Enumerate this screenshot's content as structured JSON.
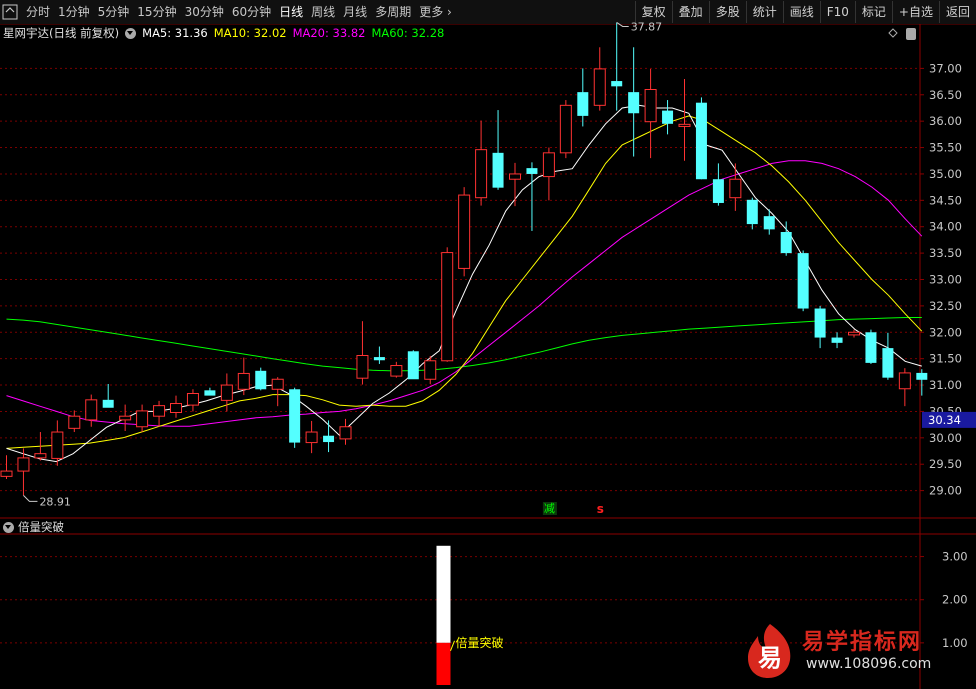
{
  "toolbar": {
    "left_items": [
      "分时",
      "1分钟",
      "5分钟",
      "15分钟",
      "30分钟",
      "60分钟",
      "日线",
      "周线",
      "月线",
      "多周期",
      "更多"
    ],
    "active": "日线",
    "right_items": [
      "复权",
      "叠加",
      "多股",
      "统计",
      "画线",
      "F10",
      "标记",
      "+自选",
      "返回"
    ]
  },
  "header": {
    "stock": "星网宇达(日线 前复权)",
    "ma5": "MA5: 31.36",
    "ma10": "MA10: 32.02",
    "ma20": "MA20: 33.82",
    "ma60": "MA60: 32.28",
    "colors": {
      "ma5": "#ffffff",
      "ma10": "#ffff00",
      "ma20": "#ff00ff",
      "ma60": "#00ff00"
    }
  },
  "sub_header": {
    "title": "倍量突破"
  },
  "annotations": {
    "high_label": "37.87",
    "low_label": "28.91",
    "current_price": "30.34",
    "minus_marker": "减",
    "s_marker": "s",
    "signal_label": "倍量突破"
  },
  "watermark": {
    "title": "易学指标网",
    "url": "www.108096.com",
    "logo_char": "易"
  },
  "chart_data": [
    {
      "type": "candlestick",
      "title": "星网宇达(日线 前复权)",
      "ylim": [
        28.5,
        37.5
      ],
      "y_ticks": [
        "37.00",
        "36.50",
        "36.00",
        "35.50",
        "35.00",
        "34.50",
        "34.00",
        "33.50",
        "33.00",
        "32.50",
        "32.00",
        "31.50",
        "31.00",
        "30.50",
        "30.00",
        "29.50",
        "29.00"
      ],
      "candles": [
        {
          "o": 29.27,
          "h": 29.67,
          "l": 29.22,
          "c": 29.37
        },
        {
          "o": 29.37,
          "h": 29.8,
          "l": 28.91,
          "c": 29.62
        },
        {
          "o": 29.62,
          "h": 30.11,
          "l": 29.57,
          "c": 29.7
        },
        {
          "o": 29.61,
          "h": 30.33,
          "l": 29.47,
          "c": 30.11
        },
        {
          "o": 30.18,
          "h": 30.52,
          "l": 30.11,
          "c": 30.41
        },
        {
          "o": 30.34,
          "h": 30.82,
          "l": 30.21,
          "c": 30.72
        },
        {
          "o": 30.72,
          "h": 31.02,
          "l": 30.58,
          "c": 30.57
        },
        {
          "o": 30.34,
          "h": 30.63,
          "l": 30.13,
          "c": 30.41
        },
        {
          "o": 30.21,
          "h": 30.63,
          "l": 30.11,
          "c": 30.51
        },
        {
          "o": 30.41,
          "h": 30.7,
          "l": 30.21,
          "c": 30.61
        },
        {
          "o": 30.48,
          "h": 30.8,
          "l": 30.38,
          "c": 30.65
        },
        {
          "o": 30.62,
          "h": 30.92,
          "l": 30.5,
          "c": 30.84
        },
        {
          "o": 30.9,
          "h": 30.95,
          "l": 30.85,
          "c": 30.8
        },
        {
          "o": 30.71,
          "h": 31.22,
          "l": 30.5,
          "c": 31.0
        },
        {
          "o": 30.92,
          "h": 31.52,
          "l": 30.81,
          "c": 31.22
        },
        {
          "o": 31.27,
          "h": 31.33,
          "l": 30.9,
          "c": 30.92
        },
        {
          "o": 30.92,
          "h": 31.15,
          "l": 30.6,
          "c": 31.11
        },
        {
          "o": 30.92,
          "h": 30.95,
          "l": 29.81,
          "c": 29.91
        },
        {
          "o": 29.91,
          "h": 30.32,
          "l": 29.71,
          "c": 30.11
        },
        {
          "o": 30.04,
          "h": 30.33,
          "l": 29.73,
          "c": 29.92
        },
        {
          "o": 29.98,
          "h": 30.36,
          "l": 29.87,
          "c": 30.21
        },
        {
          "o": 31.13,
          "h": 32.21,
          "l": 31.01,
          "c": 31.56
        },
        {
          "o": 31.53,
          "h": 31.73,
          "l": 31.4,
          "c": 31.47
        },
        {
          "o": 31.17,
          "h": 31.44,
          "l": 31.14,
          "c": 31.37
        },
        {
          "o": 31.64,
          "h": 31.66,
          "l": 31.17,
          "c": 31.11
        },
        {
          "o": 31.11,
          "h": 31.55,
          "l": 31.02,
          "c": 31.46
        },
        {
          "o": 31.46,
          "h": 33.61,
          "l": 31.44,
          "c": 33.51
        },
        {
          "o": 33.21,
          "h": 34.75,
          "l": 33.06,
          "c": 34.6
        },
        {
          "o": 34.55,
          "h": 36.01,
          "l": 34.4,
          "c": 35.46
        },
        {
          "o": 35.4,
          "h": 36.21,
          "l": 34.7,
          "c": 34.74
        },
        {
          "o": 34.9,
          "h": 35.21,
          "l": 34.39,
          "c": 35.0
        },
        {
          "o": 35.11,
          "h": 35.22,
          "l": 33.92,
          "c": 35.0
        },
        {
          "o": 34.95,
          "h": 35.5,
          "l": 34.5,
          "c": 35.4
        },
        {
          "o": 35.4,
          "h": 36.4,
          "l": 35.3,
          "c": 36.3
        },
        {
          "o": 36.55,
          "h": 37.0,
          "l": 35.9,
          "c": 36.1
        },
        {
          "o": 36.3,
          "h": 37.4,
          "l": 36.2,
          "c": 36.99
        },
        {
          "o": 36.76,
          "h": 37.87,
          "l": 36.2,
          "c": 36.66
        },
        {
          "o": 36.55,
          "h": 37.4,
          "l": 35.33,
          "c": 36.15
        },
        {
          "o": 35.99,
          "h": 36.99,
          "l": 35.3,
          "c": 36.6
        },
        {
          "o": 36.2,
          "h": 36.4,
          "l": 35.75,
          "c": 35.95
        },
        {
          "o": 35.9,
          "h": 36.8,
          "l": 35.25,
          "c": 35.94
        },
        {
          "o": 36.35,
          "h": 36.45,
          "l": 34.9,
          "c": 34.9
        },
        {
          "o": 34.9,
          "h": 35.2,
          "l": 34.4,
          "c": 34.45
        },
        {
          "o": 34.55,
          "h": 35.2,
          "l": 34.3,
          "c": 34.9
        },
        {
          "o": 34.51,
          "h": 34.55,
          "l": 33.95,
          "c": 34.05
        },
        {
          "o": 34.2,
          "h": 34.33,
          "l": 33.85,
          "c": 33.95
        },
        {
          "o": 33.9,
          "h": 34.1,
          "l": 33.45,
          "c": 33.5
        },
        {
          "o": 33.5,
          "h": 33.55,
          "l": 32.4,
          "c": 32.45
        },
        {
          "o": 32.45,
          "h": 32.5,
          "l": 31.7,
          "c": 31.9
        },
        {
          "o": 31.9,
          "h": 32.0,
          "l": 31.7,
          "c": 31.8
        },
        {
          "o": 31.95,
          "h": 32.05,
          "l": 31.9,
          "c": 32.0
        },
        {
          "o": 32.0,
          "h": 32.05,
          "l": 31.4,
          "c": 31.42
        },
        {
          "o": 31.7,
          "h": 31.99,
          "l": 31.1,
          "c": 31.14
        },
        {
          "o": 30.93,
          "h": 31.32,
          "l": 30.6,
          "c": 31.23
        },
        {
          "o": 31.23,
          "h": 31.3,
          "l": 30.8,
          "c": 31.1
        }
      ],
      "ma5": [
        29.8,
        29.7,
        29.6,
        29.55,
        29.7,
        29.95,
        30.2,
        30.35,
        30.5,
        30.5,
        30.55,
        30.62,
        30.7,
        30.8,
        30.88,
        30.97,
        31.0,
        30.83,
        30.6,
        30.35,
        30.05,
        30.35,
        30.65,
        30.85,
        31.1,
        31.4,
        31.65,
        32.4,
        33.1,
        33.65,
        34.3,
        34.7,
        34.95,
        35.05,
        35.1,
        35.55,
        35.95,
        36.25,
        36.3,
        36.25,
        36.25,
        36.15,
        35.55,
        35.45,
        35.0,
        34.55,
        34.25,
        33.9,
        33.35,
        32.8,
        32.35,
        32.05,
        31.85,
        31.7,
        31.45,
        31.36
      ],
      "ma10": [
        29.8,
        29.82,
        29.84,
        29.86,
        29.88,
        29.9,
        29.95,
        30.0,
        30.1,
        30.2,
        30.3,
        30.4,
        30.5,
        30.6,
        30.7,
        30.75,
        30.82,
        30.82,
        30.8,
        30.72,
        30.62,
        30.6,
        30.62,
        30.6,
        30.6,
        30.7,
        30.9,
        31.2,
        31.6,
        32.1,
        32.6,
        33.0,
        33.4,
        33.8,
        34.2,
        34.7,
        35.2,
        35.55,
        35.7,
        35.85,
        36.0,
        36.1,
        36.0,
        35.8,
        35.6,
        35.4,
        35.15,
        34.85,
        34.5,
        34.1,
        33.7,
        33.35,
        33.0,
        32.7,
        32.35,
        32.02
      ],
      "ma20": [
        30.8,
        30.7,
        30.6,
        30.5,
        30.4,
        30.33,
        30.3,
        30.27,
        30.25,
        30.23,
        30.22,
        30.22,
        30.26,
        30.3,
        30.34,
        30.38,
        30.4,
        30.43,
        30.45,
        30.48,
        30.5,
        30.55,
        30.62,
        30.7,
        30.8,
        30.9,
        31.05,
        31.25,
        31.5,
        31.75,
        32.0,
        32.25,
        32.5,
        32.78,
        33.05,
        33.3,
        33.55,
        33.8,
        34.0,
        34.2,
        34.4,
        34.6,
        34.75,
        34.9,
        35.0,
        35.1,
        35.2,
        35.25,
        35.25,
        35.2,
        35.1,
        34.95,
        34.75,
        34.5,
        34.15,
        33.82
      ],
      "ma60": [
        32.25,
        32.23,
        32.2,
        32.15,
        32.1,
        32.05,
        32.0,
        31.95,
        31.9,
        31.85,
        31.8,
        31.75,
        31.7,
        31.65,
        31.6,
        31.55,
        31.5,
        31.45,
        31.4,
        31.36,
        31.33,
        31.3,
        31.28,
        31.27,
        31.27,
        31.28,
        31.3,
        31.33,
        31.37,
        31.42,
        31.48,
        31.55,
        31.62,
        31.7,
        31.78,
        31.85,
        31.9,
        31.94,
        31.97,
        32.0,
        32.03,
        32.06,
        32.08,
        32.1,
        32.12,
        32.14,
        32.16,
        32.18,
        32.2,
        32.22,
        32.24,
        32.25,
        32.26,
        32.27,
        32.28,
        32.28
      ]
    },
    {
      "type": "bar",
      "title": "倍量突破",
      "ylim": [
        0.0,
        3.5
      ],
      "y_ticks": [
        "3.00",
        "2.00",
        "1.00"
      ],
      "signal_index": 27,
      "signal_value": 1.0,
      "bar_max": 3.25
    }
  ]
}
